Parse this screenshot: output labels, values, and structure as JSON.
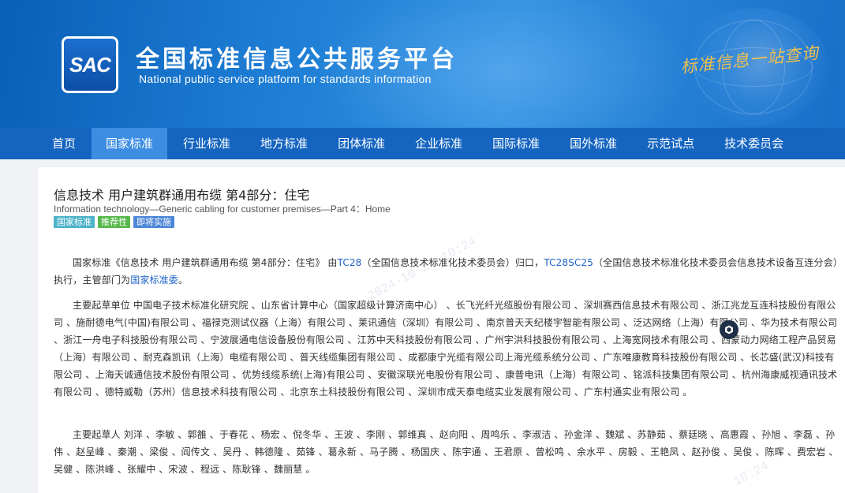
{
  "header": {
    "logo_text": "SAC",
    "title_cn": "全国标准信息公共服务平台",
    "title_en": "National public service platform  for standards information",
    "slogan": "标准信息一站查询"
  },
  "nav": {
    "items": [
      {
        "label": "首页"
      },
      {
        "label": "国家标准"
      },
      {
        "label": "行业标准"
      },
      {
        "label": "地方标准"
      },
      {
        "label": "团体标准"
      },
      {
        "label": "企业标准"
      },
      {
        "label": "国际标准"
      },
      {
        "label": "国外标准"
      },
      {
        "label": "示范试点"
      },
      {
        "label": "技术委员会"
      }
    ],
    "active_index": 1
  },
  "doc": {
    "title": "信息技术 用户建筑群通用布缆 第4部分：住宅",
    "title_en": "Information technology—Generic cabling for customer premises—Part 4：Home",
    "tags": [
      "国家标准",
      "推荐性",
      "即将实施"
    ],
    "p1": {
      "prefix": "国家标准《信息技术 用户建筑群通用布缆 第4部分：住宅》 由",
      "tc_link": "TC28",
      "tc_desc": "（全国信息技术标准化技术委员会）归口，",
      "sc_link": "TC28SC25",
      "sc_desc": "（全国信息技术标准化技术委员会信息技术设备互连分会）执行，主管部门为",
      "dept_link": "国家标准委",
      "suffix": "。"
    },
    "p2": "主要起草单位 中国电子技术标准化研究院 、山东省计算中心（国家超级计算济南中心） 、长飞光纤光缆股份有限公司 、深圳赛西信息技术有限公司 、浙江兆龙互连科技股份有限公司 、施耐德电气(中国)有限公司 、福禄克测试仪器（上海）有限公司 、莱讯通信（深圳）有限公司 、南京普天天纪楼宇智能有限公司 、泛达网络（上海）有限公司 、华为技术有限公司 、浙江一舟电子科技股份有限公司 、宁波展通电信设备股份有限公司 、江苏中天科技股份有限公司 、广州宇洪科技股份有限公司 、上海宽网技术有限公司 、西蒙动力网络工程产品贸易（上海）有限公司 、耐克森凯讯（上海）电缆有限公司 、普天线缆集团有限公司 、成都康宁光缆有限公司上海光缆系统分公司 、广东唯康教育科技股份有限公司 、长芯盛(武汉)科技有限公司 、上海天诚通信技术股份有限公司 、优势线缆系统(上海)有限公司 、安徽深联光电股份有限公司 、康普电讯（上海）有限公司 、铭派科技集团有限公司 、杭州海康威视通讯技术有限公司 、德特威勒（苏州）信息技术科技有限公司 、北京东土科技股份有限公司 、深圳市成天泰电缆实业发展有限公司 、广东村通实业有限公司 。",
    "p3": "主要起草人 刘洋 、李敏 、郭雒 、于春花 、杨宏 、倪冬华 、王波 、李刚 、郭维真 、赵向阳 、周鸣乐 、李淑洁 、孙金洋 、魏斌 、苏静茹 、蔡廷晓 、高惠霞 、孙旭 、李磊 、孙伟 、赵呈峰 、秦潮 、梁俊 、阎传文 、吴丹 、韩德隆 、茹锋 、葛永新 、马子腾 、杨国庆 、陈宇通 、王君原 、曾松鸣 、余水平 、房毅 、王艳凤 、赵孙俊 、吴俊 、陈晖 、费宏岩 、吴健 、陈洪峰 、张耀中 、宋波 、程远 、陈耿锋 、魏丽慧 。"
  },
  "colors": {
    "nav_bg": "#1565c0",
    "nav_active": "#3d8ee3",
    "link": "#1e63c6",
    "tag_national": "#4bb3c9",
    "tag_recommended": "#56b84a",
    "tag_upcoming": "#4b86d8"
  }
}
